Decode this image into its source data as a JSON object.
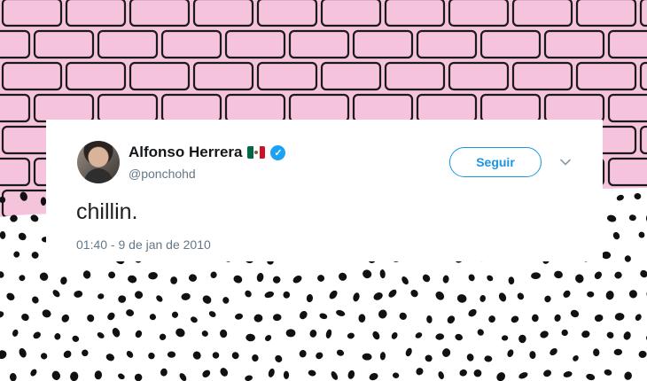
{
  "tweet": {
    "display_name": "Alfonso Herrera",
    "flag_icon": "mexico-flag-icon",
    "verified_icon": "verified-badge-icon",
    "handle": "@ponchohd",
    "follow_label": "Seguir",
    "menu_icon": "chevron-down-icon",
    "text": "chillin.",
    "timestamp": "01:40 - 9 de jan de 2010"
  },
  "colors": {
    "background_pink": "#f6c3dd",
    "brick_line": "#1a1a1a",
    "accent_blue": "#1b95e0",
    "verified_blue": "#1da1f2",
    "secondary_text": "#657786"
  }
}
